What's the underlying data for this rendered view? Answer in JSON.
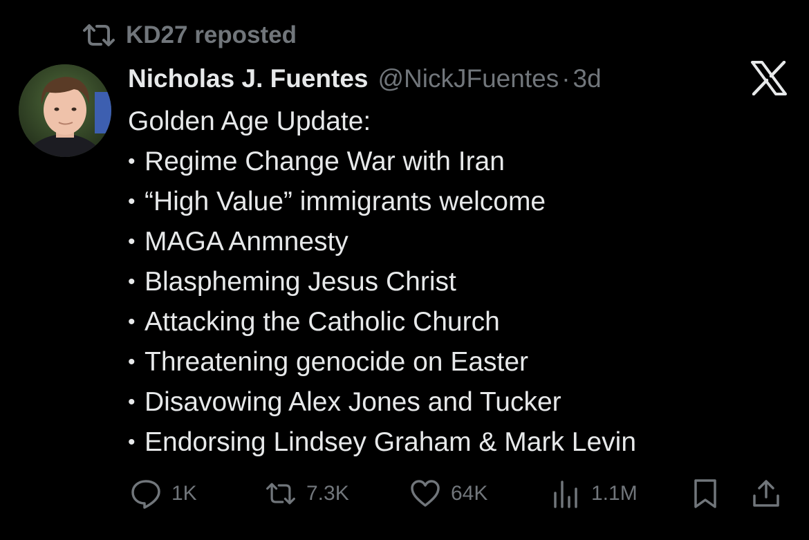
{
  "repost": {
    "label": "KD27 reposted"
  },
  "tweet": {
    "display_name": "Nicholas J. Fuentes",
    "handle": "@NickJFuentes",
    "separator": "·",
    "time": "3d",
    "intro": "Golden Age Update:",
    "bullet_char": "•",
    "bullets": [
      "Regime Change War with Iran",
      "“High Value” immigrants welcome",
      "MAGA Anmnesty",
      "Blaspheming Jesus Christ",
      "Attacking the Catholic Church",
      "Threatening genocide on Easter",
      "Disavowing Alex Jones and Tucker",
      "Endorsing Lindsey Graham & Mark Levin"
    ]
  },
  "actions": {
    "replies": "1K",
    "reposts": "7.3K",
    "likes": "64K",
    "views": "1.1M"
  },
  "icons": {
    "repost_header": "repost-icon",
    "platform": "x-logo-icon",
    "reply": "reply-icon",
    "retweet": "retweet-icon",
    "like": "heart-icon",
    "views": "views-icon",
    "bookmark": "bookmark-icon",
    "share": "share-icon"
  },
  "colors": {
    "background": "#000000",
    "text": "#e7e9ea",
    "muted": "#71767b"
  }
}
